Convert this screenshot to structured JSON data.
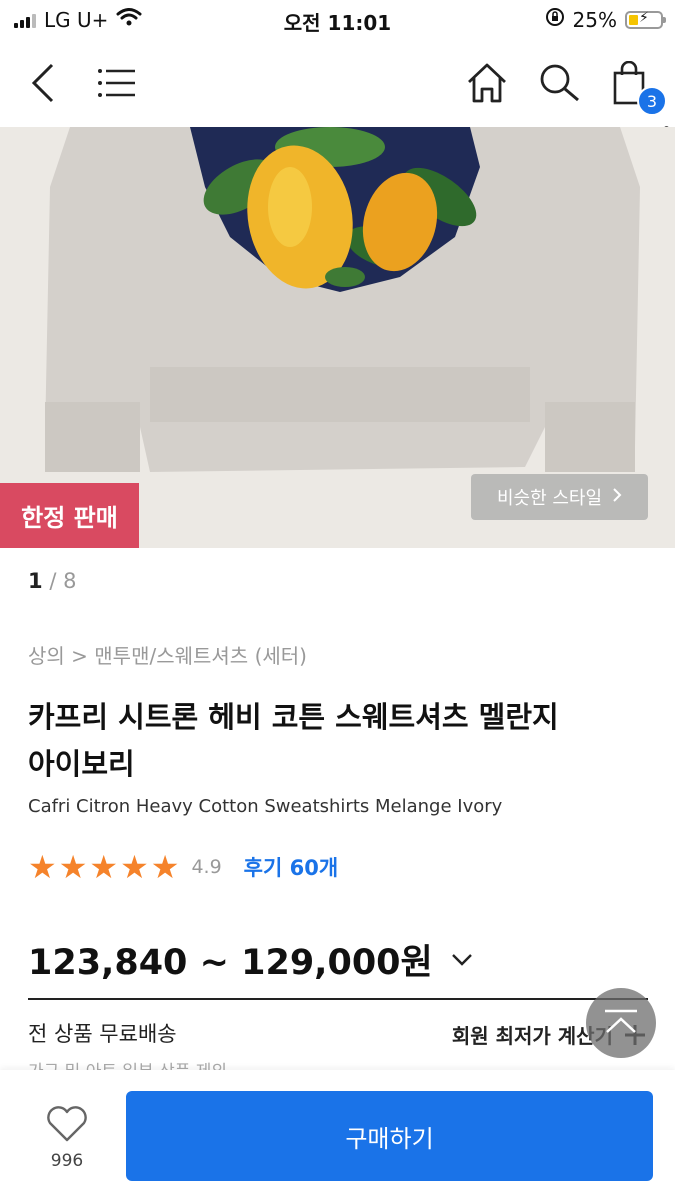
{
  "status_bar": {
    "carrier": "LG U+",
    "time": "오전 11:01",
    "battery": "25%"
  },
  "nav": {
    "back_icon": "chevron-left-icon",
    "menu_icon": "hamburger-icon",
    "home_icon": "home-icon",
    "search_icon": "search-icon",
    "cart_icon": "shopping-bag-icon",
    "cart_count": "3"
  },
  "image": {
    "limited_badge": "한정 판매",
    "similar_style_label": "비슷한 스타일",
    "pager_current": "1",
    "pager_total": "8"
  },
  "product": {
    "breadcrumb": "상의 > 맨투맨/스웨트셔츠 (세터)",
    "title_line1": "카프리 시트론 헤비 코튼 스웨트셔츠 멜란지",
    "title_line2": "아이보리",
    "subtitle": "Cafri Citron Heavy Cotton Sweatshirts Melange Ivory",
    "rating": "4.9",
    "stars": 5,
    "review_label": "후기 60개",
    "price": "123,840 ~ 129,000원",
    "free_shipping": "전 상품 무료배송",
    "member_price_label": "회원 최저가 계산기",
    "cut_text": "가구 및 아트 일부 상품 제외"
  },
  "bottom": {
    "like_count": "996",
    "buy_label": "구매하기"
  },
  "colors": {
    "accent": "#1a73e8",
    "badge": "#d94a61",
    "star": "#f5832b"
  }
}
